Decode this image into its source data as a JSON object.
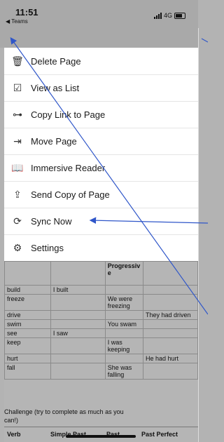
{
  "status": {
    "time": "11:51",
    "back_label": "◀ Teams",
    "network": "4G"
  },
  "toolbar": {
    "pen_icon": "pen-icon",
    "more_label": "•••"
  },
  "menu": {
    "items": [
      {
        "label": "Delete Page",
        "icon": "trash-icon"
      },
      {
        "label": "View as List",
        "icon": "checkbox-icon"
      },
      {
        "label": "Copy Link to Page",
        "icon": "link-icon"
      },
      {
        "label": "Move Page",
        "icon": "move-icon"
      },
      {
        "label": "Immersive Reader",
        "icon": "immersive-reader-icon"
      },
      {
        "label": "Send Copy of Page",
        "icon": "share-icon"
      },
      {
        "label": "Sync Now",
        "icon": "sync-icon"
      },
      {
        "label": "Settings",
        "icon": "gear-icon"
      }
    ]
  },
  "table": {
    "top_partial": "Progressiv e",
    "rows": [
      [
        "build",
        "I built",
        "",
        ""
      ],
      [
        "freeze",
        "",
        "We were freezing",
        ""
      ],
      [
        "drive",
        "",
        "",
        "They had driven"
      ],
      [
        "swim",
        "",
        "You swam",
        ""
      ],
      [
        "see",
        "I saw",
        "",
        ""
      ],
      [
        "keep",
        "",
        "I was keeping",
        ""
      ],
      [
        "hurt",
        "",
        "",
        "He had hurt"
      ],
      [
        "fall",
        "",
        "She was falling",
        ""
      ]
    ]
  },
  "challenge": "Challenge (try to complete as much as you can!)",
  "header_row": [
    "Verb",
    "Simple Past",
    "Past",
    "Past Perfect"
  ]
}
